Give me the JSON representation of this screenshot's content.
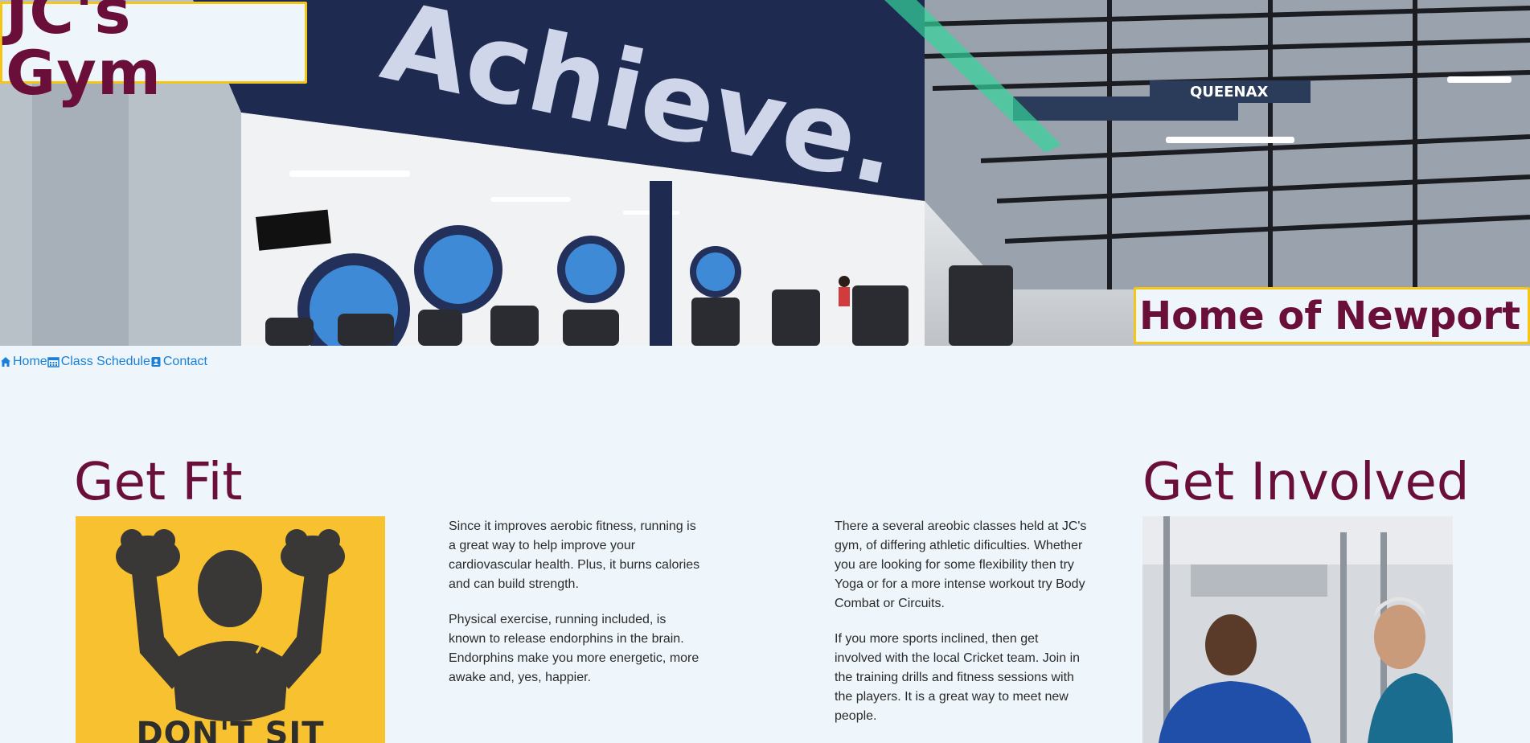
{
  "header": {
    "brand": "JC's Gym",
    "tagline": "Home of Newport CC",
    "hero_wall_text": "Achieve.",
    "hero_sign_text": "QUEENAX"
  },
  "nav": {
    "items": [
      {
        "label": "Home",
        "icon": "home-icon"
      },
      {
        "label": "Class Schedule",
        "icon": "calendar-icon"
      },
      {
        "label": "Contact",
        "icon": "contact-icon"
      }
    ]
  },
  "main": {
    "get_fit": {
      "title": "Get Fit",
      "poster_text": "DON'T SIT"
    },
    "column_a": {
      "paragraphs": [
        "Since it improves aerobic fitness, running is a great way to help improve your cardiovascular health. Plus, it burns calories and can build strength.",
        "Physical exercise, running included, is known to release endorphins in the brain. Endorphins make you more energetic, more awake and, yes, happier."
      ]
    },
    "column_b": {
      "paragraphs": [
        "There a several areobic classes held at JC's gym, of differing athletic dificulties. Whether you are looking for some flexibility then try Yoga or for a more intense workout try Body Combat or Circuits.",
        "If you more sports inclined, then get involved with the local Cricket team. Join in the training drills and fitness sessions with the players. It is a great way to meet new people."
      ]
    },
    "get_involved": {
      "title": "Get Involved"
    }
  },
  "colors": {
    "brand": "#6a0f3a",
    "accent_border": "#f5c518",
    "link": "#1a7fd6",
    "background": "#eef6fb"
  }
}
